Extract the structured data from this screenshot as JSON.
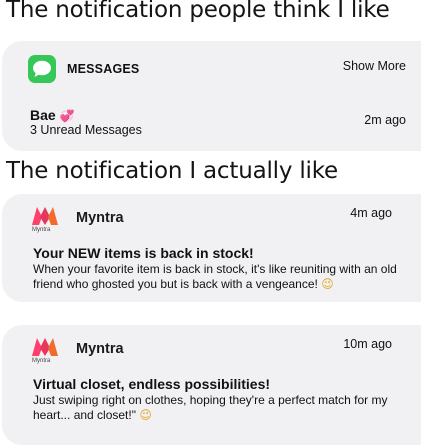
{
  "headings": {
    "top": "The notification people think I like",
    "bottom": "The notification I actually like"
  },
  "sms": {
    "app": "MESSAGES",
    "show_more": "Show More",
    "sender": "Bae",
    "sender_emoji": "💞",
    "subline": "3 Unread Messages",
    "time": "2m ago",
    "icon": "message-bubble-icon",
    "icon_color": "#37c759"
  },
  "myntra": {
    "brand_color": "#e7365b",
    "notifications": [
      {
        "app": "Myntra",
        "logo_sub": "Myntra",
        "time": "4m ago",
        "title": "Your NEW items is back in stock!",
        "body": "When your favorite item is back in stock, it's like reuniting with an old friend who ghosted you but is back with a vengeance!",
        "emoji": "😉"
      },
      {
        "app": "Myntra",
        "logo_sub": "Myntra",
        "time": "10m ago",
        "title": "Virtual closet, endless possibilities!",
        "body": "Just swiping right on clothes, hoping they're a perfect match for my heart... and closet!\"",
        "emoji": "😉"
      }
    ]
  }
}
